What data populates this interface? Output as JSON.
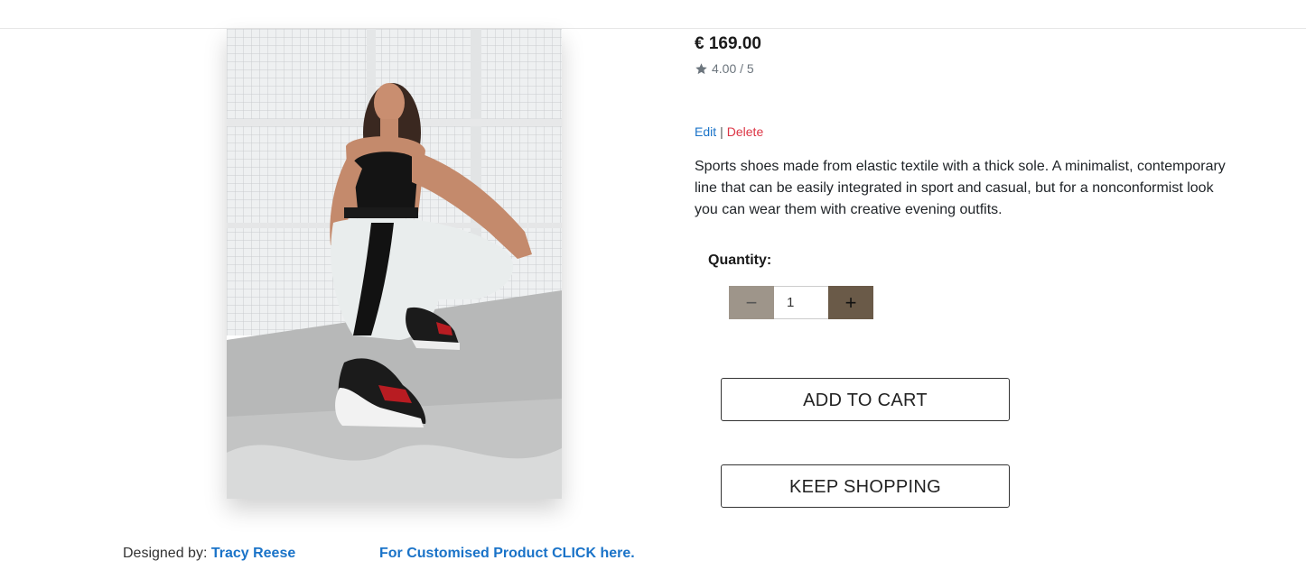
{
  "product": {
    "price": "€ 169.00",
    "rating": "4.00 / 5",
    "description": "Sports shoes made from elastic textile with a thick sole. A minimalist, contemporary line that can be easily integrated in sport and casual, but for a nonconformist look you can wear them with creative evening outfits."
  },
  "admin_actions": {
    "edit_label": "Edit",
    "separator": "|",
    "delete_label": "Delete"
  },
  "quantity": {
    "label": "Quantity:",
    "value": "1",
    "minus_symbol": "−",
    "plus_symbol": "+"
  },
  "buttons": {
    "add_to_cart": "ADD TO CART",
    "keep_shopping": "KEEP SHOPPING"
  },
  "footer": {
    "designed_by_label": "Designed by:",
    "designer_name": "Tracy Reese",
    "customise_link": "For Customised Product CLICK here."
  },
  "colors": {
    "link": "#1a73c8",
    "delete": "#dc3545",
    "minus_button": "#9e958a",
    "plus_button": "#6a5a48"
  },
  "icons": {
    "rating": "star-icon"
  }
}
